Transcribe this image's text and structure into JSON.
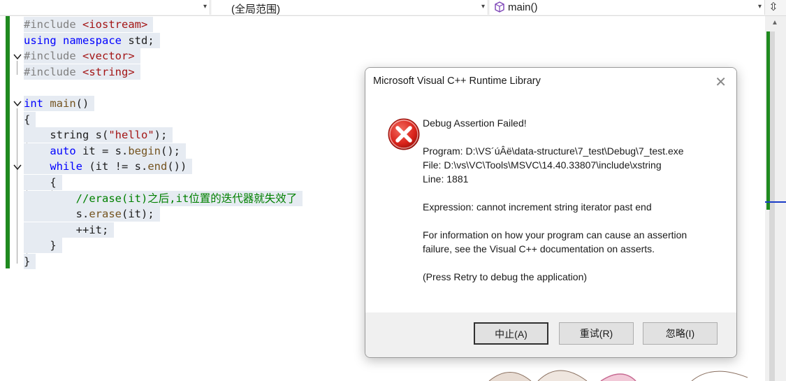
{
  "navbar": {
    "scope_label": "(全局范围)",
    "function_label": "main()",
    "first_dropdown_arrow": "▾",
    "second_dropdown_arrow": "▾",
    "third_dropdown_arrow": "▾",
    "split_icon": "⇳"
  },
  "code": {
    "lines": [
      {
        "parts": [
          [
            "#include ",
            "pre"
          ],
          [
            "<iostream>",
            "inc"
          ]
        ]
      },
      {
        "parts": [
          [
            "using ",
            "kw"
          ],
          [
            "namespace ",
            "kw"
          ],
          [
            "std;",
            "txt"
          ]
        ]
      },
      {
        "parts": [
          [
            "#include ",
            "pre"
          ],
          [
            "<vector>",
            "inc"
          ]
        ]
      },
      {
        "parts": [
          [
            "#include ",
            "pre"
          ],
          [
            "<string>",
            "inc"
          ]
        ]
      },
      {
        "parts": []
      },
      {
        "parts": [
          [
            "int ",
            "kw"
          ],
          [
            "main",
            "fn"
          ],
          [
            "()",
            "txt"
          ]
        ]
      },
      {
        "parts": [
          [
            "{",
            "txt"
          ]
        ]
      },
      {
        "parts": [
          [
            "    string ",
            "txt"
          ],
          [
            "s(",
            "txt"
          ],
          [
            "\"hello\"",
            "str"
          ],
          [
            ");",
            "txt"
          ]
        ]
      },
      {
        "parts": [
          [
            "    ",
            "txt"
          ],
          [
            "auto ",
            "kw"
          ],
          [
            "it = s.",
            "txt"
          ],
          [
            "begin",
            "fn"
          ],
          [
            "();",
            "txt"
          ]
        ]
      },
      {
        "parts": [
          [
            "    ",
            "txt"
          ],
          [
            "while ",
            "kw"
          ],
          [
            "(it != s.",
            "txt"
          ],
          [
            "end",
            "fn"
          ],
          [
            "())",
            "txt"
          ]
        ]
      },
      {
        "parts": [
          [
            "    {",
            "txt"
          ]
        ]
      },
      {
        "parts": [
          [
            "        ",
            "txt"
          ],
          [
            "//erase(it)之后,it位置的迭代器就失效了",
            "cm"
          ]
        ]
      },
      {
        "parts": [
          [
            "        s.",
            "txt"
          ],
          [
            "erase",
            "fn"
          ],
          [
            "(it);",
            "txt"
          ]
        ]
      },
      {
        "parts": [
          [
            "        ++it;",
            "txt"
          ]
        ]
      },
      {
        "parts": [
          [
            "    }",
            "txt"
          ]
        ]
      },
      {
        "parts": [
          [
            "}",
            "txt"
          ]
        ]
      }
    ]
  },
  "colors": {
    "change_bar": "#1f8a1f",
    "keyword": "#0000ff",
    "comment": "#008000",
    "string": "#a31515",
    "preprocessor": "#808080",
    "error_red": "#d9231b"
  },
  "dialog": {
    "title": "Microsoft Visual C++ Runtime Library",
    "close_icon": "✕",
    "icon": "error-icon",
    "heading": "Debug Assertion Failed!",
    "program": "Program: D:\\VS´úÂë\\data-structure\\7_test\\Debug\\7_test.exe",
    "file": "File: D:\\vs\\VC\\Tools\\MSVC\\14.40.33807\\include\\xstring",
    "line": "Line: 1881",
    "expression": "Expression: cannot increment string iterator past end",
    "info_1": "For information on how your program can cause an assertion",
    "info_2": "failure, see the Visual C++ documentation on asserts.",
    "retry_hint": "(Press Retry to debug the application)",
    "buttons": {
      "abort": "中止(A)",
      "retry": "重试(R)",
      "ignore": "忽略(I)"
    }
  }
}
